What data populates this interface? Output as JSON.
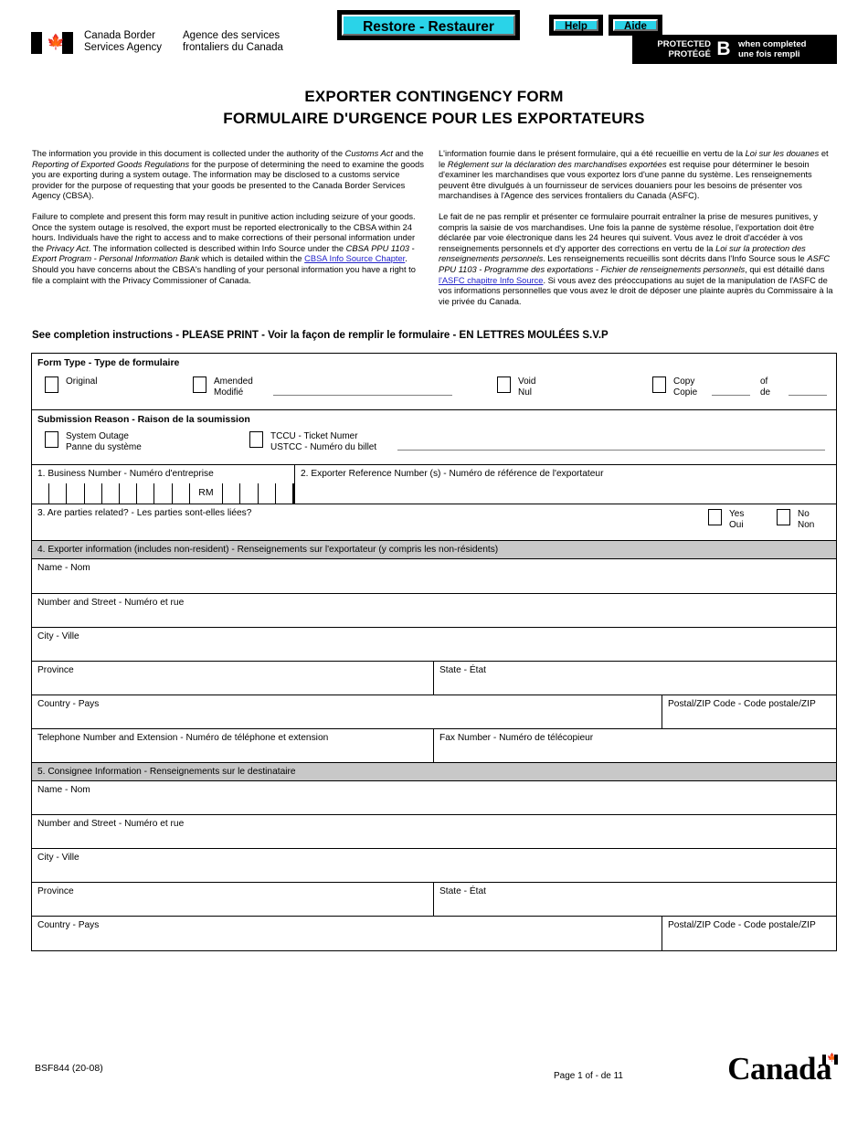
{
  "header": {
    "agency_en": "Canada Border\nServices Agency",
    "agency_en_l1": "Canada Border",
    "agency_en_l2": "Services Agency",
    "agency_fr_l1": "Agence des services",
    "agency_fr_l2": "frontaliers du Canada",
    "restore_label": "Restore - Restaurer",
    "help_label": "Help",
    "aide_label": "Aide",
    "protected_l1": "PROTECTED",
    "protected_l2": "PROTÉGÉ",
    "protected_level": "B",
    "protected_note_l1": "when completed",
    "protected_note_l2": "une fois rempli",
    "accent_color": "#2ad3e8"
  },
  "title": {
    "en": "EXPORTER CONTINGENCY FORM",
    "fr": "FORMULAIRE D'URGENCE POUR LES EXPORTATEURS"
  },
  "notice": {
    "en_p1_a": "The information you provide in this document is collected under the authority of the ",
    "en_p1_i1": "Customs Act",
    "en_p1_b": " and the ",
    "en_p1_i2": "Reporting of Exported Goods Regulations",
    "en_p1_c": " for the purpose of determining the need to examine the goods you are exporting during a system outage. The information may be disclosed to a customs service provider for the purpose of requesting that your goods be presented to the Canada Border Services Agency (CBSA).",
    "en_p2_a": "Failure to complete and present this form may result in punitive action including seizure of your goods. Once the system outage is resolved, the export must be reported electronically to the CBSA within 24 hours. Individuals have the right to access and to make corrections of their personal information under the ",
    "en_p2_i1": "Privacy Act",
    "en_p2_b": ".  The information collected is described within Info Source under the ",
    "en_p2_i2": "CBSA PPU 1103 - Export Program - Personal Information Bank",
    "en_p2_c": " which is detailed within the ",
    "en_p2_link": "CBSA Info Source Chapter",
    "en_p2_d": ".  Should you have concerns about the CBSA's handling of your personal information you have a right to file a complaint with the Privacy Commissioner of Canada.",
    "fr_p1_a": "L'information fournie dans le présent formulaire, qui a été recueillie en vertu de la ",
    "fr_p1_i1": "Loi sur les douanes",
    "fr_p1_b": " et le ",
    "fr_p1_i2": "Réglement sur la déclaration des marchandises exportées",
    "fr_p1_c": " est requise pour déterminer le besoin d'examiner les marchandises que vous exportez lors d'une panne du système. Les renseignements peuvent être divulgués à un fournisseur de services douaniers pour les besoins de présenter vos marchandises à l'Agence des services frontaliers du Canada (ASFC).",
    "fr_p2_a": "Le fait de ne pas remplir et présenter ce formulaire pourrait entraîner la prise de mesures punitives, y compris la saisie de vos marchandises. Une fois la panne de système résolue, l'exportation doit être déclarée par voie électronique dans les 24 heures qui suivent.  Vous avez le droit d'accéder à vos renseignements personnels et d'y apporter des corrections en vertu de la ",
    "fr_p2_i1": "Loi sur la protection des renseignements personnels",
    "fr_p2_b": ".  Les renseignements recueillis sont décrits dans l'Info Source sous le ",
    "fr_p2_i2": "ASFC PPU 1103 - Programme des exportations - Fichier de renseignements personnels",
    "fr_p2_c": ", qui est détaillé dans ",
    "fr_p2_link": "l'ASFC chapitre Info Source",
    "fr_p2_d": ".  Si vous avez des préoccupations au sujet de la manipulation de l'ASFC de vos informations personnelles que vous avez le droit de déposer une plainte auprès du Commissaire à la vie privée du Canada.",
    "link_color": "#2323c8"
  },
  "instruction": "See completion instructions - PLEASE PRINT - Voir la façon de remplir le formulaire - EN LETTRES MOULÉES S.V.P",
  "form_type": {
    "heading": "Form Type - Type de formulaire",
    "original": "Original",
    "amended_l1": "Amended",
    "amended_l2": "Modifié",
    "void_l1": "Void",
    "void_l2": "Nul",
    "copy_l1": "Copy",
    "copy_l2": "Copie",
    "of_l1": "of",
    "of_l2": "de"
  },
  "submission_reason": {
    "heading": "Submission Reason - Raison de la soumission",
    "outage_l1": "System Outage",
    "outage_l2": "Panne du système",
    "ticket_l1": "TCCU  - Ticket Numer",
    "ticket_l2": "USTCC - Numéro du billet"
  },
  "fields": {
    "business_number": "1.  Business Number - Numéro d'entreprise",
    "rm": "RM",
    "exporter_reference": "2.  Exporter Reference Number (s) - Numéro de référence de l'exportateur",
    "parties_related": "3.  Are parties related? - Les parties sont-elles liées?",
    "yes_l1": "Yes",
    "yes_l2": "Oui",
    "no_l1": "No",
    "no_l2": "Non"
  },
  "section4": {
    "heading": "4.  Exporter information (includes non-resident) - Renseignements sur l'exportateur (y compris les non-résidents)",
    "name": "Name - Nom",
    "street": "Number and Street - Numéro et rue",
    "city": "City - Ville",
    "province": "Province",
    "state": "State - État",
    "country": "Country - Pays",
    "postal": "Postal/ZIP Code - Code postale/ZIP",
    "telephone": "Telephone Number and Extension - Numéro de téléphone et extension",
    "fax": "Fax Number - Numéro de télécopieur"
  },
  "section5": {
    "heading": "5.  Consignee Information - Renseignements sur le destinataire",
    "name": "Name - Nom",
    "street": "Number and Street - Numéro et rue",
    "city": "City - Ville",
    "province": "Province",
    "state": "State - État",
    "country": "Country - Pays",
    "postal": "Postal/ZIP Code - Code postale/ZIP"
  },
  "footer": {
    "form_code": "BSF844 (20-08)",
    "page": "Page 1 of - de 11",
    "wordmark": "Canada"
  }
}
